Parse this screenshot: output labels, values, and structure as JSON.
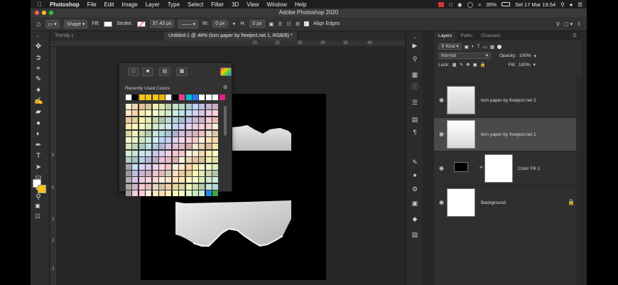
{
  "menubar": {
    "items": [
      "Photoshop",
      "File",
      "Edit",
      "Image",
      "Layer",
      "Type",
      "Select",
      "Filter",
      "3D",
      "View",
      "Window",
      "Help"
    ],
    "battery": "35%",
    "datetime": "Sel 17 Mar  19.54"
  },
  "title": "Adobe Photoshop 2020",
  "options": {
    "shape_mode": "Shape",
    "fill_label": "Fill:",
    "stroke_label": "Stroke:",
    "stroke_size": "37,43 px",
    "w_label": "W:",
    "w_value": "0 px",
    "h_label": "H:",
    "h_value": "0 px",
    "align_edges": "Align Edges"
  },
  "doc_tabs": {
    "tab1": "Trendy c",
    "tab2": "Untitled-1 @ 48% (torn paper by freeject.net 1, RGB/8) *"
  },
  "rulers": {
    "top": [
      "15",
      "20",
      "25",
      "30",
      "35",
      "40"
    ],
    "left": [
      "5",
      "0",
      "2",
      "2",
      "3"
    ]
  },
  "swatches": {
    "title": "Recently Used Colors",
    "recent": [
      "#ffffff",
      "#000000",
      "#f5c518",
      "#f5c518",
      "#f5c518",
      "#f2b100",
      "#ffffff",
      "#000000",
      "#e83e8c",
      "#00bcd4",
      "#2979ff",
      "#ffffff",
      "#ffffff",
      "#ffffff",
      "#e91e8c"
    ],
    "palette_colors": [
      "#fbeed8",
      "#fde2b8",
      "#fcd5a5",
      "#fde9a8",
      "#fff5b3",
      "#f1f8b6",
      "#dcefb8",
      "#c7e8c0",
      "#bfe6d6",
      "#bce3ea",
      "#b9d6f2",
      "#c5c6ef",
      "#d7c3ea",
      "#ebc6e3",
      "#f8c7d4",
      "#f6c2c0"
    ],
    "accent_colors": [
      "#1e88e5",
      "#43a047"
    ]
  },
  "panel": {
    "tabs": [
      "Layers",
      "Paths",
      "Channels"
    ],
    "kind": "Kind",
    "blend": "Normal",
    "opacity_label": "Opacity:",
    "opacity": "100%",
    "lock_label": "Lock:",
    "fill_label": "Fill:",
    "fill": "100%",
    "layers": [
      {
        "name": "torn paper by freeject.net 2"
      },
      {
        "name": "torn paper by freeject.net 1"
      },
      {
        "name": "Color Fill 1"
      },
      {
        "name": "Background"
      }
    ]
  },
  "colors": {
    "foreground": "#ffffff",
    "background": "#f5c518"
  }
}
